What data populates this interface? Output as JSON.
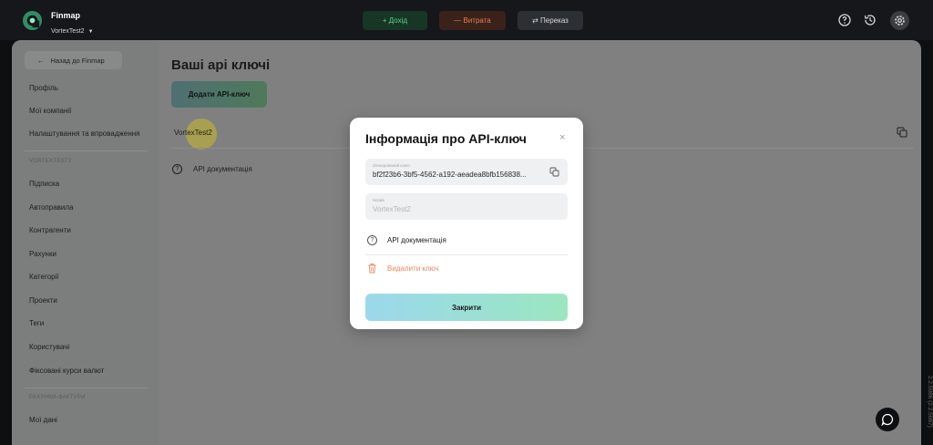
{
  "header": {
    "brand_name": "Finmap",
    "account_name": "VortexTest2",
    "income_label": "+ Дохід",
    "expense_label": "— Витрата",
    "transfer_label": "⇄ Переказ"
  },
  "sidebar": {
    "back_label": "Назад до Finmap",
    "items": [
      "Профіль",
      "Мої компанії",
      "Налаштування та впровадження"
    ],
    "section_company": "VORTEXTEST2",
    "company_items": [
      "Підписка",
      "Автоправила",
      "Контрагенти",
      "Рахунки",
      "Категорії",
      "Проекти",
      "Теги",
      "Користувачі",
      "Фіксовані курси валют"
    ],
    "section_invoices": "РАХУНКИ-ФАКТУРИ",
    "invoice_items": [
      "Мої дані"
    ]
  },
  "main": {
    "title": "Ваші api ключі",
    "add_button": "Додати API-ключ",
    "key_name": "VortexTest2",
    "api_doc_label": "API документація"
  },
  "modal": {
    "title": "Інформація про API-ключ",
    "close_icon": "×",
    "key_field_label": "Згенерований ключ",
    "key_value": "bf2f23b6-3bf5-4562-a192-aeadea8bfb156838...",
    "name_field_label": "Назва",
    "name_value": "VortexTest2",
    "api_doc_label": "API документація",
    "delete_label": "Видалити ключ",
    "close_button": "Закрити"
  },
  "version": "2.2.5086 (2.2.5087)"
}
